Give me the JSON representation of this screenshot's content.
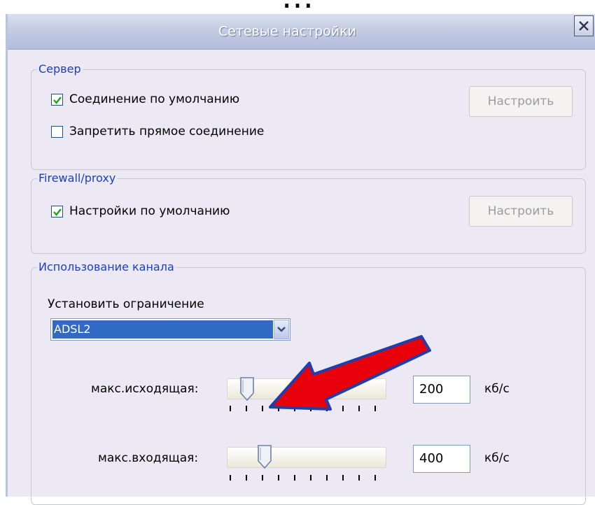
{
  "window": {
    "title": "Сетевые настройки"
  },
  "server": {
    "legend": "Сервер",
    "default_connection": {
      "label": "Соединение по умолчанию",
      "checked": true
    },
    "forbid_direct": {
      "label": "Запретить прямое соединение",
      "checked": false
    },
    "configure_label": "Настроить"
  },
  "firewall": {
    "legend": "Firewall/proxy",
    "default_settings": {
      "label": "Настройки по умолчанию",
      "checked": true
    },
    "configure_label": "Настроить"
  },
  "channel": {
    "legend": "Использование канала",
    "limit_label": "Установить ограничение",
    "limit_value": "ADSL2",
    "upload": {
      "label": "макс.исходящая:",
      "value": "200",
      "unit": "кб/с"
    },
    "download": {
      "label": "макс.входящая:",
      "value": "400",
      "unit": "кб/с"
    }
  },
  "annotation": {
    "arrow_color": "#e8000b",
    "arrow_outline": "#1f3fae"
  }
}
